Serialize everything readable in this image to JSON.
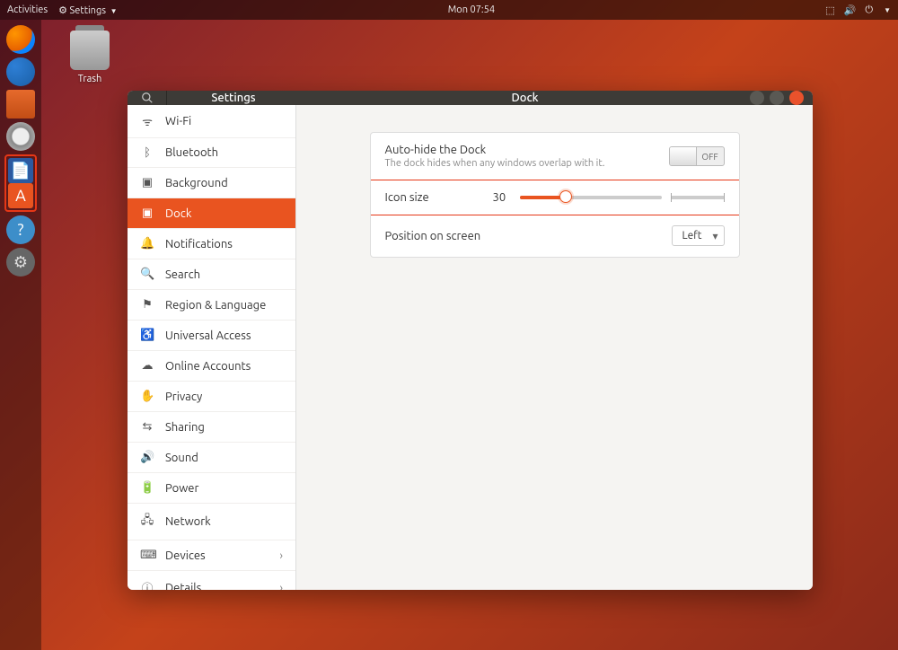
{
  "topbar": {
    "activities": "Activities",
    "app_menu": "Settings",
    "clock": "Mon 07:54"
  },
  "desktop": {
    "trash_label": "Trash"
  },
  "dock_icons": {
    "firefox": "firefox",
    "thunderbird": "thunderbird",
    "files": "files",
    "rhythmbox": "rhythmbox",
    "libreoffice_writer": "libreoffice-writer",
    "ubuntu_software": "ubuntu-software",
    "help": "help",
    "settings": "settings"
  },
  "window": {
    "app_title": "Settings",
    "page_title": "Dock"
  },
  "sidebar": {
    "items": [
      {
        "label": "Wi-Fi",
        "icon": "wifi"
      },
      {
        "label": "Bluetooth",
        "icon": "bt"
      },
      {
        "label": "Background",
        "icon": "bg"
      },
      {
        "label": "Dock",
        "icon": "dock",
        "active": true
      },
      {
        "label": "Notifications",
        "icon": "bell"
      },
      {
        "label": "Search",
        "icon": "search"
      },
      {
        "label": "Region & Language",
        "icon": "region"
      },
      {
        "label": "Universal Access",
        "icon": "access"
      },
      {
        "label": "Online Accounts",
        "icon": "online"
      },
      {
        "label": "Privacy",
        "icon": "privacy"
      },
      {
        "label": "Sharing",
        "icon": "share"
      },
      {
        "label": "Sound",
        "icon": "sound"
      },
      {
        "label": "Power",
        "icon": "power"
      },
      {
        "label": "Network",
        "icon": "network"
      },
      {
        "label": "Devices",
        "icon": "devices",
        "chevron": true
      },
      {
        "label": "Details",
        "icon": "details",
        "chevron": true
      }
    ]
  },
  "dock_settings": {
    "autohide": {
      "title": "Auto-hide the Dock",
      "subtitle": "The dock hides when any windows overlap with it.",
      "state": "OFF"
    },
    "icon_size": {
      "label": "Icon size",
      "value": "30"
    },
    "position": {
      "label": "Position on screen",
      "value": "Left"
    }
  }
}
